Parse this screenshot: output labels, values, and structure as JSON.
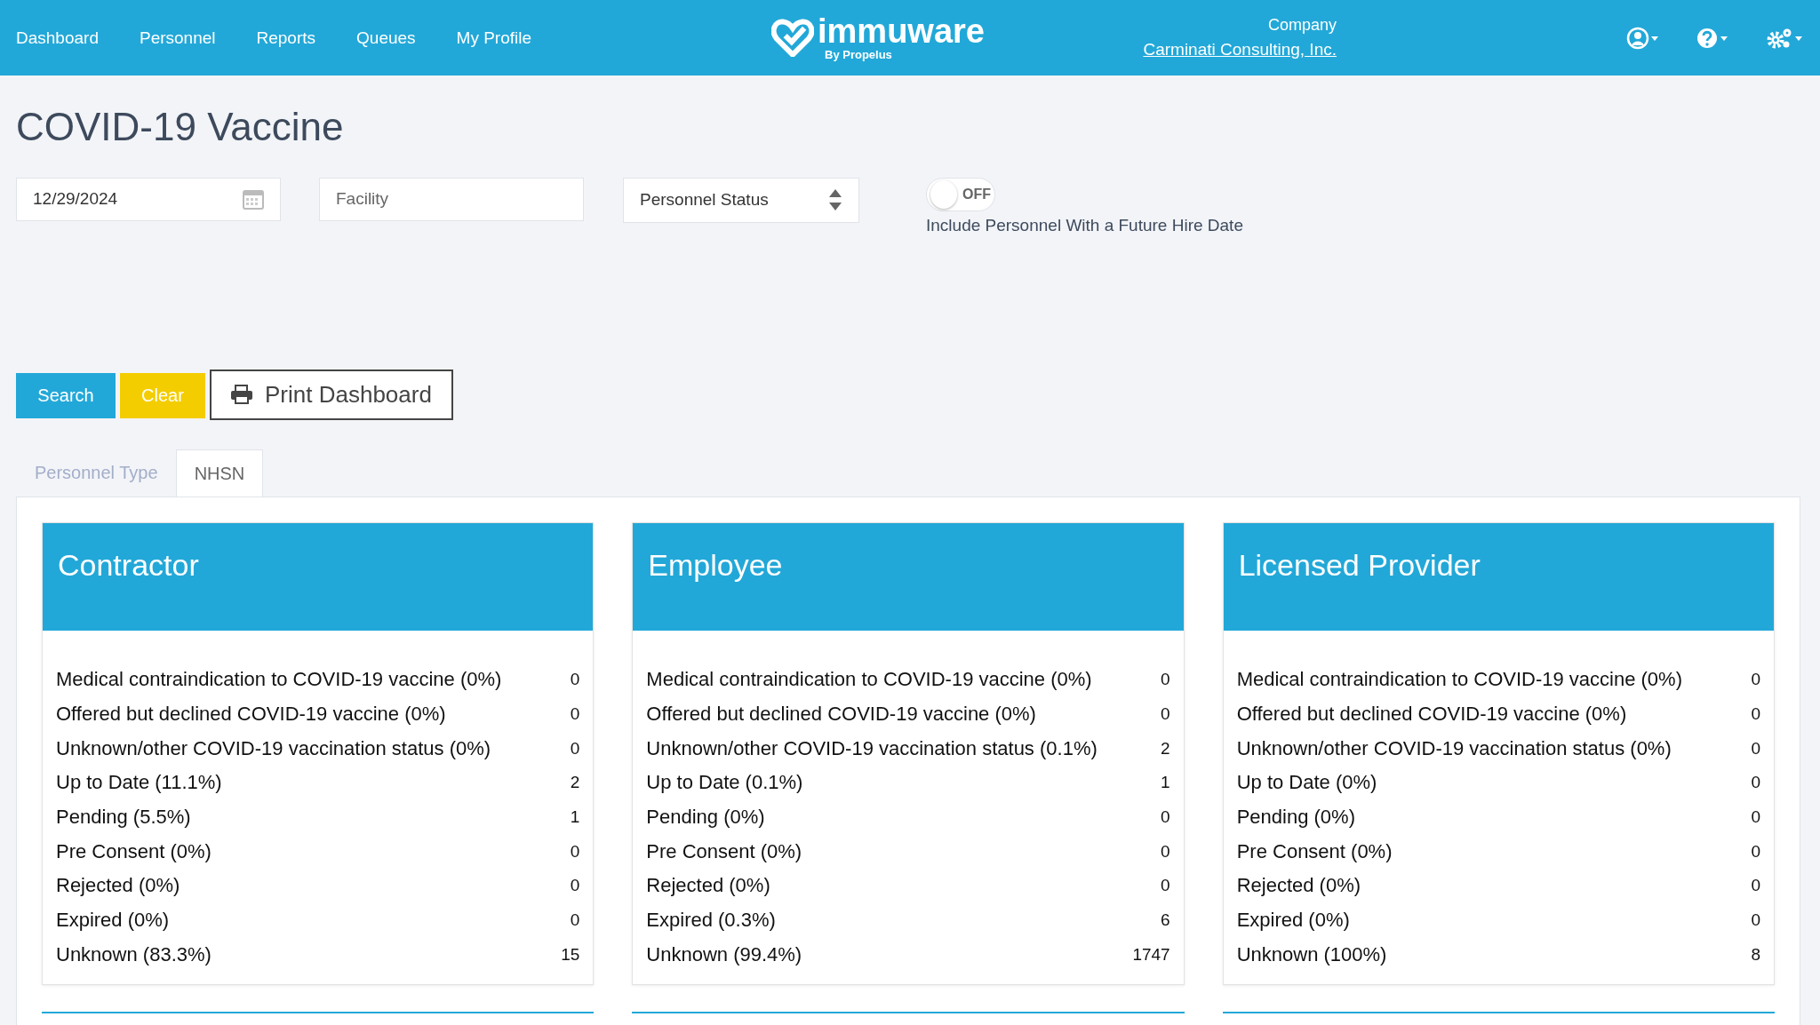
{
  "nav": {
    "items": [
      {
        "label": "Dashboard"
      },
      {
        "label": "Personnel"
      },
      {
        "label": "Reports"
      },
      {
        "label": "Queues"
      },
      {
        "label": "My Profile"
      }
    ],
    "logo": {
      "name": "immuware",
      "byline": "By Propelus"
    },
    "company": {
      "label": "Company",
      "name": "Carminati Consulting, Inc."
    }
  },
  "page_title": "COVID-19 Vaccine",
  "filters": {
    "date": "12/29/2024",
    "facility_placeholder": "Facility",
    "status": "Personnel Status",
    "future_hire": {
      "on": false,
      "switch_label": "OFF",
      "label": "Include Personnel With a Future Hire Date"
    }
  },
  "buttons": [
    {
      "kind": "primary",
      "label": "Search"
    },
    {
      "kind": "warning",
      "label": "Clear"
    },
    {
      "kind": "print",
      "label": "Print Dashboard"
    }
  ],
  "tabs": [
    {
      "label": "Personnel Type",
      "selected": false
    },
    {
      "label": "NHSN",
      "selected": true
    }
  ],
  "cards": [
    {
      "title": "Contractor",
      "rows": [
        {
          "label": "Medical contraindication to COVID-19 vaccine (0%)",
          "count": "0"
        },
        {
          "label": "Offered but declined COVID-19 vaccine (0%)",
          "count": "0"
        },
        {
          "label": "Unknown/other COVID-19 vaccination status (0%)",
          "count": "0"
        },
        {
          "label": "Up to Date (11.1%)",
          "count": "2"
        },
        {
          "label": "Pending (5.5%)",
          "count": "1"
        },
        {
          "label": "Pre Consent (0%)",
          "count": "0"
        },
        {
          "label": "Rejected (0%)",
          "count": "0"
        },
        {
          "label": "Expired (0%)",
          "count": "0"
        },
        {
          "label": "Unknown (83.3%)",
          "count": "15"
        }
      ]
    },
    {
      "title": "Employee",
      "rows": [
        {
          "label": "Medical contraindication to COVID-19 vaccine (0%)",
          "count": "0"
        },
        {
          "label": "Offered but declined COVID-19 vaccine (0%)",
          "count": "0"
        },
        {
          "label": "Unknown/other COVID-19 vaccination status (0.1%)",
          "count": "2"
        },
        {
          "label": "Up to Date (0.1%)",
          "count": "1"
        },
        {
          "label": "Pending (0%)",
          "count": "0"
        },
        {
          "label": "Pre Consent (0%)",
          "count": "0"
        },
        {
          "label": "Rejected (0%)",
          "count": "0"
        },
        {
          "label": "Expired (0.3%)",
          "count": "6"
        },
        {
          "label": "Unknown (99.4%)",
          "count": "1747"
        }
      ]
    },
    {
      "title": "Licensed Provider",
      "rows": [
        {
          "label": "Medical contraindication to COVID-19 vaccine (0%)",
          "count": "0"
        },
        {
          "label": "Offered but declined COVID-19 vaccine (0%)",
          "count": "0"
        },
        {
          "label": "Unknown/other COVID-19 vaccination status (0%)",
          "count": "0"
        },
        {
          "label": "Up to Date (0%)",
          "count": "0"
        },
        {
          "label": "Pending (0%)",
          "count": "0"
        },
        {
          "label": "Pre Consent (0%)",
          "count": "0"
        },
        {
          "label": "Rejected (0%)",
          "count": "0"
        },
        {
          "label": "Expired (0%)",
          "count": "0"
        },
        {
          "label": "Unknown (100%)",
          "count": "8"
        }
      ]
    }
  ]
}
